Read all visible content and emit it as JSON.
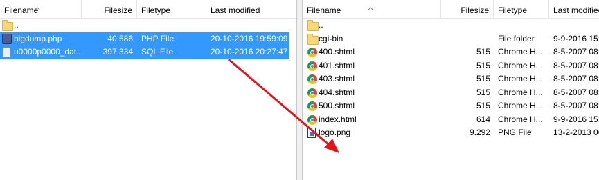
{
  "local": {
    "columns": {
      "filename": "Filename",
      "filesize": "Filesize",
      "filetype": "Filetype",
      "modified": "Last modified"
    },
    "rows": [
      {
        "name": "..",
        "size": "",
        "type": "",
        "modified": "",
        "icon": "folder-icon",
        "selected": false
      },
      {
        "name": "bigdump.php",
        "size": "40.586",
        "type": "PHP File",
        "modified": "20-10-2016 19:59:09",
        "icon": "php-file-icon",
        "selected": true
      },
      {
        "name": "u0000p0000_dat...",
        "size": "397.334",
        "type": "SQL File",
        "modified": "20-10-2016 20:27:47",
        "icon": "sql-file-icon",
        "selected": true
      }
    ]
  },
  "remote": {
    "columns": {
      "filename": "Filename",
      "filesize": "Filesize",
      "filetype": "Filetype",
      "modified": "Last modified"
    },
    "rows": [
      {
        "name": "..",
        "size": "",
        "type": "",
        "modified": "",
        "icon": "folder-icon"
      },
      {
        "name": "cgi-bin",
        "size": "",
        "type": "File folder",
        "modified": "9-9-2016 15:",
        "icon": "folder-icon"
      },
      {
        "name": "400.shtml",
        "size": "515",
        "type": "Chrome H...",
        "modified": "8-5-2007 08:",
        "icon": "chrome-icon"
      },
      {
        "name": "401.shtml",
        "size": "515",
        "type": "Chrome H...",
        "modified": "8-5-2007 08:",
        "icon": "chrome-icon"
      },
      {
        "name": "403.shtml",
        "size": "515",
        "type": "Chrome H...",
        "modified": "8-5-2007 08:",
        "icon": "chrome-icon"
      },
      {
        "name": "404.shtml",
        "size": "515",
        "type": "Chrome H...",
        "modified": "8-5-2007 08:",
        "icon": "chrome-icon"
      },
      {
        "name": "500.shtml",
        "size": "515",
        "type": "Chrome H...",
        "modified": "8-5-2007 08:",
        "icon": "chrome-icon"
      },
      {
        "name": "index.html",
        "size": "614",
        "type": "Chrome H...",
        "modified": "9-9-2016 15:",
        "icon": "chrome-icon"
      },
      {
        "name": "logo.png",
        "size": "9.292",
        "type": "PNG File",
        "modified": "13-2-2013 0C",
        "icon": "png-file-icon"
      }
    ]
  },
  "annotation": {
    "icon": "drag-arrow-icon",
    "color": "#e3141b"
  },
  "colors": {
    "selection": "#3399ff",
    "selection_text": "#ffffff"
  }
}
